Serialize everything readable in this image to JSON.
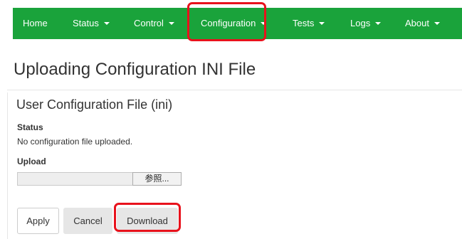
{
  "navbar": {
    "items": [
      {
        "label": "Home",
        "dropdown": false
      },
      {
        "label": "Status",
        "dropdown": true
      },
      {
        "label": "Control",
        "dropdown": true
      },
      {
        "label": "Configuration",
        "dropdown": true
      },
      {
        "label": "Tests",
        "dropdown": true
      },
      {
        "label": "Logs",
        "dropdown": true
      },
      {
        "label": "About",
        "dropdown": true
      }
    ]
  },
  "page": {
    "title": "Uploading Configuration INI File"
  },
  "section": {
    "title": "User Configuration File (ini)",
    "status_label": "Status",
    "status_text": "No configuration file uploaded.",
    "upload_label": "Upload",
    "browse_label": "参照..."
  },
  "buttons": {
    "apply": "Apply",
    "cancel": "Cancel",
    "download": "Download"
  },
  "colors": {
    "navbar_bg": "#1aa33b",
    "highlight": "#e8121c"
  }
}
